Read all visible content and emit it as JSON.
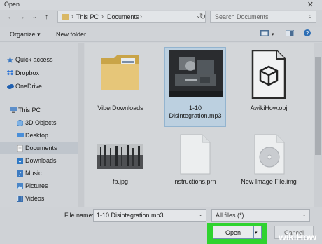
{
  "window": {
    "title": "Open",
    "close_glyph": "✕"
  },
  "nav": {
    "back": "←",
    "forward": "→",
    "up": "↑",
    "recent": "⌄"
  },
  "address": {
    "segments": [
      "This PC",
      "Documents"
    ],
    "chevron": "›",
    "refresh": "↻",
    "dropdown": "⌄"
  },
  "search": {
    "placeholder": "Search Documents",
    "icon": "⌕"
  },
  "toolbar": {
    "organize_label": "Organize ▾",
    "new_folder_label": "New folder"
  },
  "sidebar": {
    "items": [
      {
        "label": "Quick access",
        "icon": "star-icon"
      },
      {
        "label": "Dropbox",
        "icon": "dropbox-icon"
      },
      {
        "label": "OneDrive",
        "icon": "cloud-icon"
      },
      {
        "label": "This PC",
        "icon": "computer-icon"
      },
      {
        "label": "3D Objects",
        "icon": "cube-icon"
      },
      {
        "label": "Desktop",
        "icon": "desktop-icon"
      },
      {
        "label": "Documents",
        "icon": "documents-icon",
        "selected": true
      },
      {
        "label": "Downloads",
        "icon": "download-icon"
      },
      {
        "label": "Music",
        "icon": "music-icon"
      },
      {
        "label": "Pictures",
        "icon": "pictures-icon"
      },
      {
        "label": "Videos",
        "icon": "videos-icon"
      }
    ]
  },
  "files": [
    {
      "name": "ViberDownloads",
      "kind": "folder"
    },
    {
      "name": "1-10 Disintegration.mp3",
      "kind": "album-art",
      "selected": true
    },
    {
      "name": "AwikiHow.obj",
      "kind": "obj-file"
    },
    {
      "name": "fb.jpg",
      "kind": "image"
    },
    {
      "name": "instructions.prn",
      "kind": "blank-file"
    },
    {
      "name": "New Image File.img",
      "kind": "disc-image"
    }
  ],
  "file_name_field": {
    "label": "File name:",
    "value": "1-10 Disintegration.mp3",
    "dropdown": "⌄"
  },
  "file_type": {
    "value": "All files (*)",
    "dropdown": "⌄"
  },
  "buttons": {
    "open": "Open",
    "open_dropdown": "▾",
    "cancel": "Cancel"
  },
  "watermark": {
    "text": "wikiHow"
  },
  "colors": {
    "highlight": "#2fd32f",
    "selection": "#bcd0e0",
    "folder": "#d9b865"
  }
}
